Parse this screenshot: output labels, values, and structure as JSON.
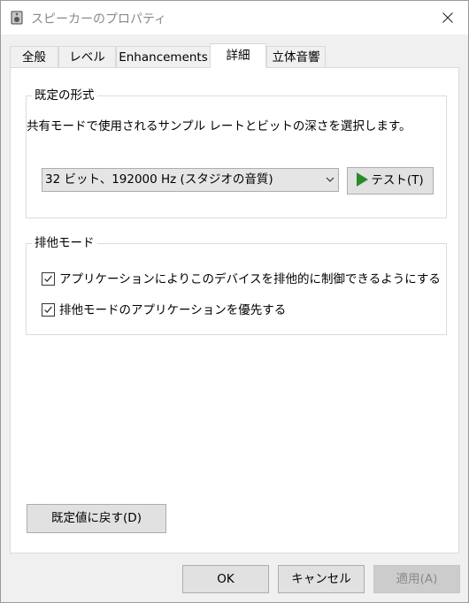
{
  "window": {
    "title": "スピーカーのプロパティ"
  },
  "tabs": [
    {
      "label": "全般"
    },
    {
      "label": "レベル"
    },
    {
      "label": "Enhancements"
    },
    {
      "label": "詳細"
    },
    {
      "label": "立体音響"
    }
  ],
  "default_format": {
    "group_label": "既定の形式",
    "description": "共有モードで使用されるサンプル レートとビットの深さを選択します。",
    "selected_value": "32 ビット、192000 Hz (スタジオの音質)",
    "test_button": "テスト(T)"
  },
  "exclusive_mode": {
    "group_label": "排他モード",
    "options": [
      {
        "label": "アプリケーションによりこのデバイスを排他的に制御できるようにする",
        "checked": true
      },
      {
        "label": "排他モードのアプリケーションを優先する",
        "checked": true
      }
    ]
  },
  "reset_button": "既定値に戻す(D)",
  "footer": {
    "ok": "OK",
    "cancel": "キャンセル",
    "apply": "適用(A)"
  }
}
